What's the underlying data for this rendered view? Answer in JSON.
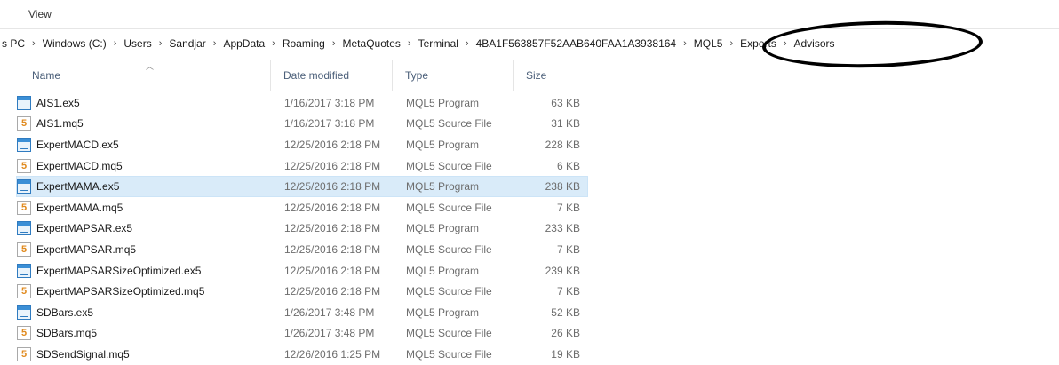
{
  "ribbon": {
    "view_tab": "View"
  },
  "breadcrumb": [
    "s PC",
    "Windows (C:)",
    "Users",
    "Sandjar",
    "AppData",
    "Roaming",
    "MetaQuotes",
    "Terminal",
    "4BA1F563857F52AAB640FAA1A3938164",
    "MQL5",
    "Experts",
    "Advisors"
  ],
  "breadcrumb_separator": "›",
  "columns": {
    "name": "Name",
    "date": "Date modified",
    "type": "Type",
    "size": "Size"
  },
  "files": [
    {
      "icon": "program-icon",
      "name": "AIS1.ex5",
      "date": "1/16/2017 3:18 PM",
      "type": "MQL5 Program",
      "size": "63 KB",
      "selected": false
    },
    {
      "icon": "source-file-icon",
      "name": "AIS1.mq5",
      "date": "1/16/2017 3:18 PM",
      "type": "MQL5 Source File",
      "size": "31 KB",
      "selected": false
    },
    {
      "icon": "program-icon",
      "name": "ExpertMACD.ex5",
      "date": "12/25/2016 2:18 PM",
      "type": "MQL5 Program",
      "size": "228 KB",
      "selected": false
    },
    {
      "icon": "source-file-icon",
      "name": "ExpertMACD.mq5",
      "date": "12/25/2016 2:18 PM",
      "type": "MQL5 Source File",
      "size": "6 KB",
      "selected": false
    },
    {
      "icon": "program-icon",
      "name": "ExpertMAMA.ex5",
      "date": "12/25/2016 2:18 PM",
      "type": "MQL5 Program",
      "size": "238 KB",
      "selected": true
    },
    {
      "icon": "source-file-icon",
      "name": "ExpertMAMA.mq5",
      "date": "12/25/2016 2:18 PM",
      "type": "MQL5 Source File",
      "size": "7 KB",
      "selected": false
    },
    {
      "icon": "program-icon",
      "name": "ExpertMAPSAR.ex5",
      "date": "12/25/2016 2:18 PM",
      "type": "MQL5 Program",
      "size": "233 KB",
      "selected": false
    },
    {
      "icon": "source-file-icon",
      "name": "ExpertMAPSAR.mq5",
      "date": "12/25/2016 2:18 PM",
      "type": "MQL5 Source File",
      "size": "7 KB",
      "selected": false
    },
    {
      "icon": "program-icon",
      "name": "ExpertMAPSARSizeOptimized.ex5",
      "date": "12/25/2016 2:18 PM",
      "type": "MQL5 Program",
      "size": "239 KB",
      "selected": false
    },
    {
      "icon": "source-file-icon",
      "name": "ExpertMAPSARSizeOptimized.mq5",
      "date": "12/25/2016 2:18 PM",
      "type": "MQL5 Source File",
      "size": "7 KB",
      "selected": false
    },
    {
      "icon": "program-icon",
      "name": "SDBars.ex5",
      "date": "1/26/2017 3:48 PM",
      "type": "MQL5 Program",
      "size": "52 KB",
      "selected": false
    },
    {
      "icon": "source-file-icon",
      "name": "SDBars.mq5",
      "date": "1/26/2017 3:48 PM",
      "type": "MQL5 Source File",
      "size": "26 KB",
      "selected": false
    },
    {
      "icon": "source-file-icon",
      "name": "SDSendSignal.mq5",
      "date": "12/26/2016 1:25 PM",
      "type": "MQL5 Source File",
      "size": "19 KB",
      "selected": false
    }
  ]
}
